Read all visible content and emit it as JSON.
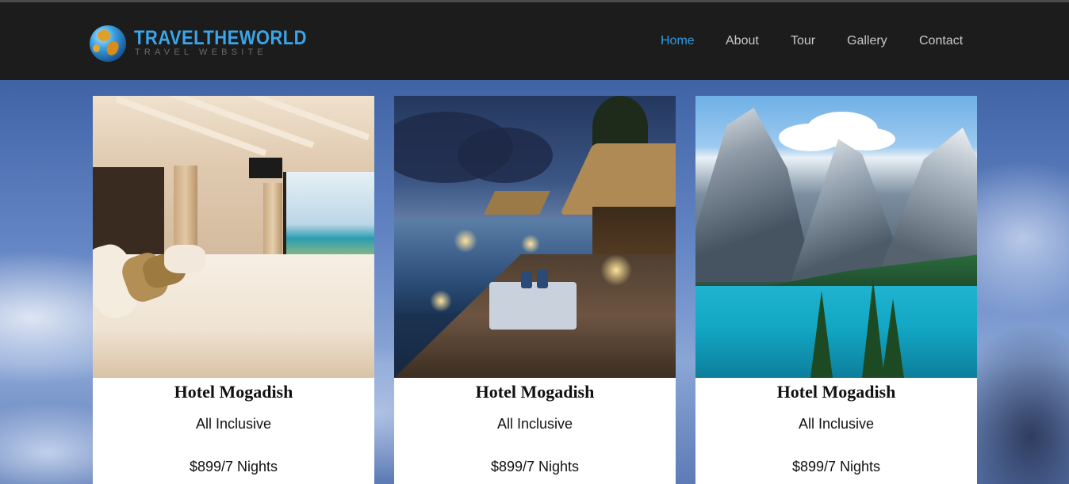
{
  "header": {
    "logo_title": "TRAVELTHEWORLD",
    "logo_subtitle": "TRAVEL WEBSITE",
    "accent_color": "#2b9be3",
    "nav": [
      {
        "label": "Home",
        "active": true
      },
      {
        "label": "About",
        "active": false
      },
      {
        "label": "Tour",
        "active": false
      },
      {
        "label": "Gallery",
        "active": false
      },
      {
        "label": "Contact",
        "active": false
      }
    ]
  },
  "cards": [
    {
      "image": "hotel-bedroom-photo",
      "title": "Hotel Mogadish",
      "subtitle": "All Inclusive",
      "price": "$899/7 Nights"
    },
    {
      "image": "overwater-resort-photo",
      "title": "Hotel Mogadish",
      "subtitle": "All Inclusive",
      "price": "$899/7 Nights"
    },
    {
      "image": "mountain-lake-photo",
      "title": "Hotel Mogadish",
      "subtitle": "All Inclusive",
      "price": "$899/7 Nights"
    }
  ]
}
